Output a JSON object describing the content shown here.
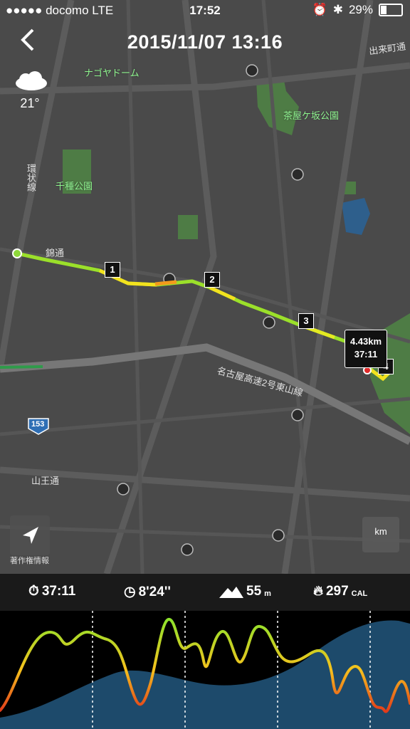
{
  "status_bar": {
    "carrier": "●●●●● docomo  LTE",
    "time": "17:52",
    "battery": "29%"
  },
  "header": {
    "title": "2015/11/07  13:16"
  },
  "weather": {
    "icon": "cloud-icon",
    "temp": "21°"
  },
  "map": {
    "labels": {
      "nagoya_dome": "ナゴヤドーム",
      "chayagasaka": "茶屋ケ坂公園",
      "chikusa": "千種公園",
      "nishiki": "錦通",
      "kanjo": "環状線",
      "expressway": "名古屋高速2号東山線",
      "sannou": "山王通",
      "demachi": "出来町通",
      "route_shield": "153"
    },
    "markers": [
      "1",
      "2",
      "3",
      "4"
    ],
    "tooltip": {
      "distance": "4.43km",
      "time": "37:11"
    },
    "km_button": "km",
    "copyright": "著作権情報"
  },
  "stats": {
    "duration": "37:11",
    "pace": "8'24''",
    "elevation_value": "55",
    "elevation_unit": "m",
    "calories_value": "297",
    "calories_unit": "CAL"
  },
  "colors": {
    "track_green": "#9be02a",
    "track_yellow": "#f2e21e",
    "track_orange": "#f39a1c",
    "elevation_fill": "#1d4a6b"
  }
}
